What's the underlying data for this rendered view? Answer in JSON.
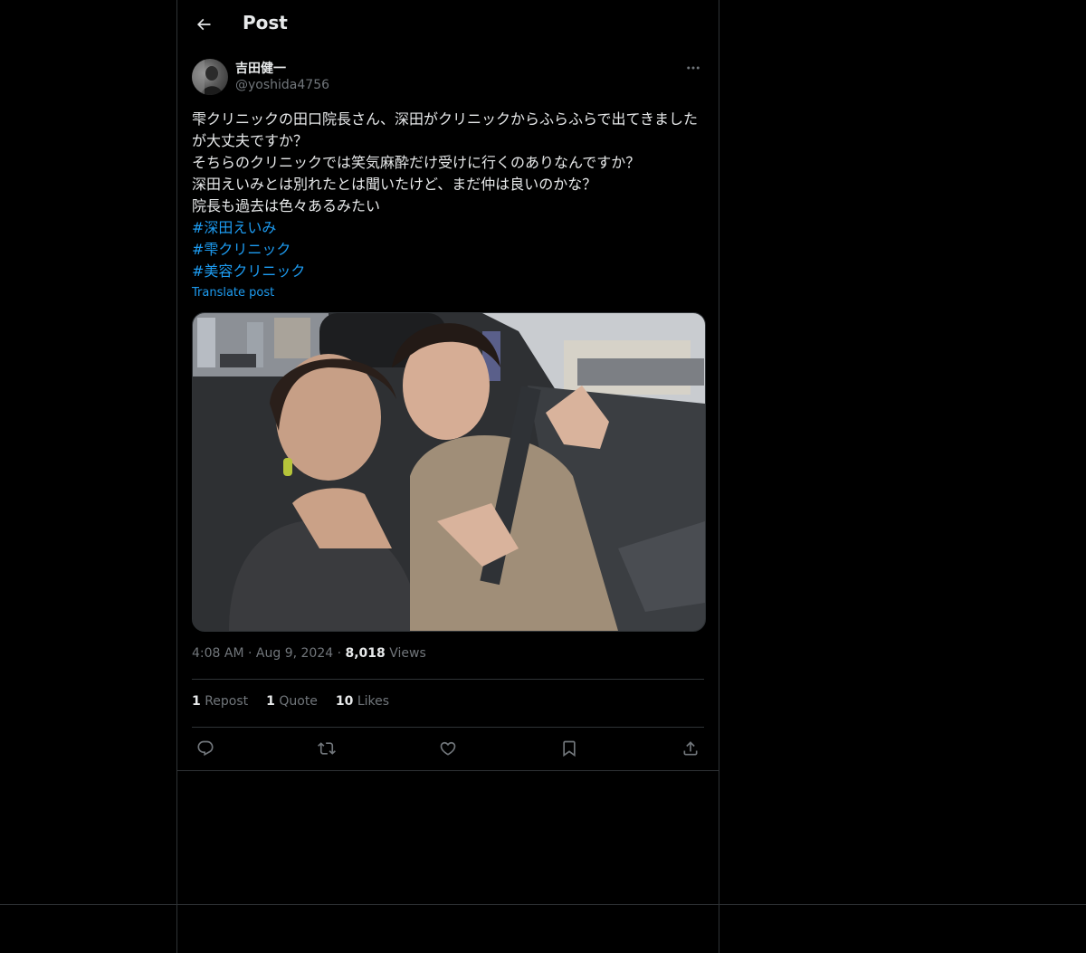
{
  "header": {
    "title": "Post",
    "back_icon": "arrow-left-icon"
  },
  "author": {
    "display_name": "吉田健一",
    "handle": "@yoshida4756",
    "more_icon": "more-horizontal-icon"
  },
  "post": {
    "lines": [
      "雫クリニックの田口院長さん、深田がクリニックからふらふらで出てきましたが大丈夫ですか？",
      "そちらのクリニックでは笑気麻酔だけ受けに行くのありなんですか？",
      "深田えいみとは別れたとは聞いたけど、まだ仲は良いのかな？",
      "院長も過去は色々あるみたい"
    ],
    "hashtags": [
      "#深田えいみ",
      "#雫クリニック",
      "#美容クリニック"
    ],
    "translate_label": "Translate post",
    "link_color": "#1d9bf0"
  },
  "meta": {
    "time": "4:08 AM",
    "separator": "·",
    "date": "Aug 9, 2024",
    "views_count": "8,018",
    "views_label": "Views"
  },
  "stats": {
    "reposts_count": "1",
    "reposts_label": "Repost",
    "quotes_count": "1",
    "quotes_label": "Quote",
    "likes_count": "10",
    "likes_label": "Likes"
  },
  "actions": [
    "reply-icon",
    "repost-icon",
    "like-icon",
    "bookmark-icon",
    "share-icon"
  ]
}
